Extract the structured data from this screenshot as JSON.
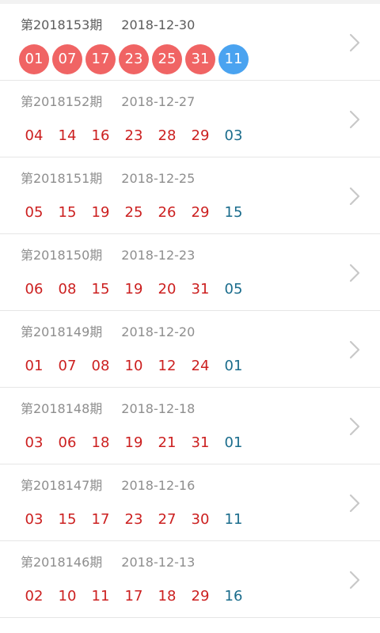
{
  "draws": [
    {
      "period": "第2018153期",
      "date": "2018-12-30",
      "red": [
        "01",
        "07",
        "17",
        "23",
        "25",
        "31"
      ],
      "blue": "11",
      "highlighted": true
    },
    {
      "period": "第2018152期",
      "date": "2018-12-27",
      "red": [
        "04",
        "14",
        "16",
        "23",
        "28",
        "29"
      ],
      "blue": "03"
    },
    {
      "period": "第2018151期",
      "date": "2018-12-25",
      "red": [
        "05",
        "15",
        "19",
        "25",
        "26",
        "29"
      ],
      "blue": "15"
    },
    {
      "period": "第2018150期",
      "date": "2018-12-23",
      "red": [
        "06",
        "08",
        "15",
        "19",
        "20",
        "31"
      ],
      "blue": "05"
    },
    {
      "period": "第2018149期",
      "date": "2018-12-20",
      "red": [
        "01",
        "07",
        "08",
        "10",
        "12",
        "24"
      ],
      "blue": "01"
    },
    {
      "period": "第2018148期",
      "date": "2018-12-18",
      "red": [
        "03",
        "06",
        "18",
        "19",
        "21",
        "31"
      ],
      "blue": "01"
    },
    {
      "period": "第2018147期",
      "date": "2018-12-16",
      "red": [
        "03",
        "15",
        "17",
        "23",
        "27",
        "30"
      ],
      "blue": "11"
    },
    {
      "period": "第2018146期",
      "date": "2018-12-13",
      "red": [
        "02",
        "10",
        "11",
        "17",
        "18",
        "29"
      ],
      "blue": "16"
    }
  ],
  "colors": {
    "red_ball": "#f06464",
    "blue_ball": "#4aa3f0",
    "red_text": "#cc2020",
    "blue_text": "#1a6c8c"
  },
  "icons": {
    "row_arrow": "chevron-right-icon"
  }
}
